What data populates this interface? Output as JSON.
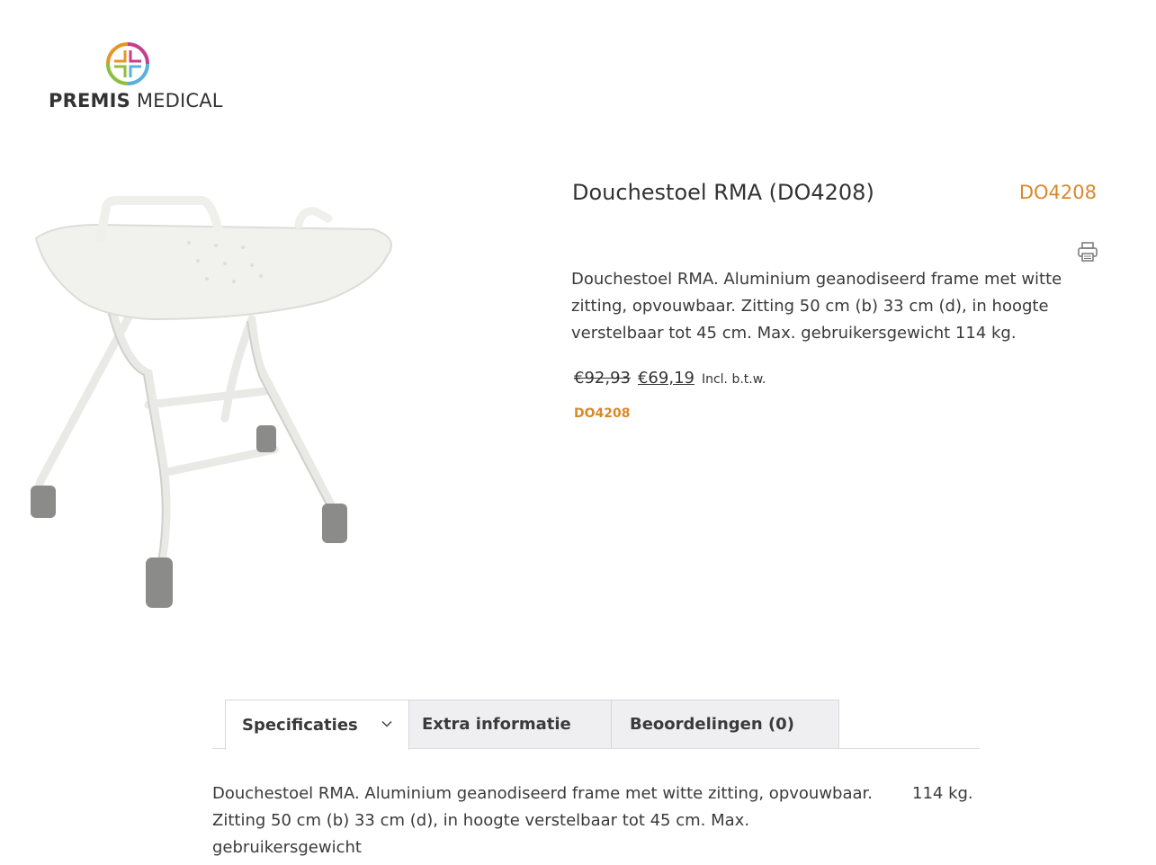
{
  "brand": {
    "name_bold": "PREMIS",
    "name_regular": " MEDICAL",
    "logo_icon": "medical-cross-logo"
  },
  "product": {
    "title": "Douchestoel RMA (DO4208)",
    "sku": "DO4208",
    "description": "Douchestoel RMA. Aluminium geanodiseerd frame met witte zitting, opvouwbaar. Zitting 50 cm (b) 33 cm (d), in hoogte verstelbaar tot 45 cm. Max. gebruikersgewicht 114 kg.",
    "price_old": "€92,93",
    "price_new": "€69,19",
    "price_note": "Incl. b.t.w.",
    "sku_small": "DO4208",
    "image_icon": "shower-stool-image"
  },
  "tabs": [
    {
      "label": "Specificaties",
      "active": true
    },
    {
      "label": "Extra informatie",
      "active": false
    },
    {
      "label": "Beoordelingen (0)",
      "active": false
    }
  ],
  "tab_content": {
    "text": "Douchestoel RMA. Aluminium geanodiseerd frame met witte zitting, opvouwbaar. Zitting 50 cm (b) 33 cm (d), in hoogte verstelbaar tot 45 cm. Max. gebruikersgewicht",
    "overflow": "114 kg."
  },
  "colors": {
    "accent": "#d9892a",
    "text": "#3a3a3a",
    "tab_inactive_bg": "#efeff1"
  }
}
